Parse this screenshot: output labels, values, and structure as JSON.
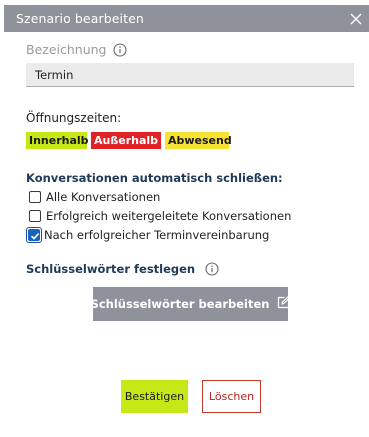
{
  "dialog": {
    "title": "Szenario bearbeiten",
    "close_icon": "close-icon"
  },
  "name_field": {
    "label": "Bezeichnung",
    "value": "Termin",
    "info_icon": "info-icon"
  },
  "opening_hours": {
    "label": "Öffnungszeiten:",
    "badges": [
      {
        "label": "Innerhalb",
        "color": "#c6e817"
      },
      {
        "label": "Außerhalb",
        "color": "#e02326"
      },
      {
        "label": "Abwesend",
        "color": "#f5e232"
      }
    ]
  },
  "auto_close": {
    "title": "Konversationen automatisch schließen:",
    "options": [
      {
        "label": "Alle Konversationen",
        "checked": false
      },
      {
        "label": "Erfolgreich weitergeleitete Konversationen",
        "checked": false
      },
      {
        "label": "Nach erfolgreicher Terminvereinbarung",
        "checked": true
      }
    ]
  },
  "keywords": {
    "title": "Schlüsselwörter festlegen",
    "edit_button": "Schlüsselwörter bearbeiten",
    "edit_icon": "edit-icon"
  },
  "footer": {
    "confirm": "Bestätigen",
    "delete": "Löschen"
  },
  "colors": {
    "header": "#8e939b",
    "accent_green": "#c6e817",
    "accent_red": "#e02326",
    "accent_yellow": "#f5e232",
    "checkbox_checked": "#1565c0",
    "section_title": "#1e3a57"
  }
}
